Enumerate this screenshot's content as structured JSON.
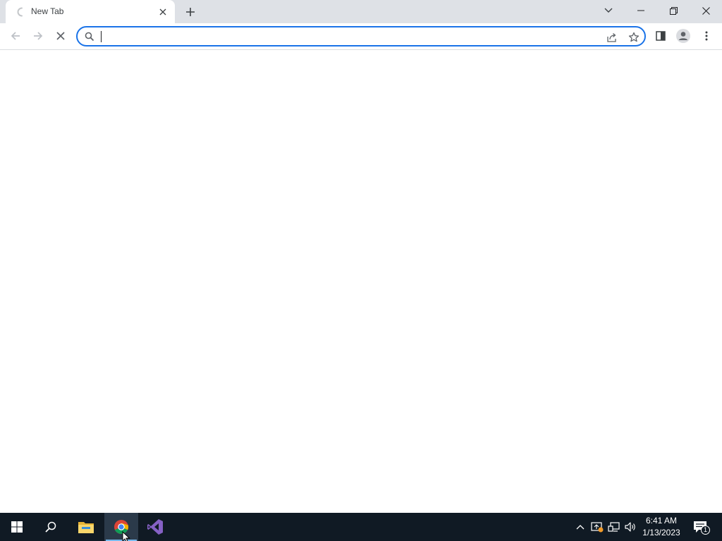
{
  "browser": {
    "tab": {
      "title": "New Tab",
      "loading": true
    },
    "window_controls": [
      "tab-search",
      "minimize",
      "restore",
      "close"
    ],
    "omnibox": {
      "value": "",
      "placeholder": "",
      "focused": true
    },
    "colors": {
      "accent": "#1a73e8",
      "tabstrip": "#dee1e6"
    }
  },
  "taskbar": {
    "apps": [
      "start",
      "search",
      "file-explorer",
      "google-chrome",
      "visual-studio"
    ],
    "active_app": "google-chrome",
    "clock": {
      "time": "6:41 AM",
      "date": "1/13/2023"
    },
    "notifications_count": "1"
  }
}
